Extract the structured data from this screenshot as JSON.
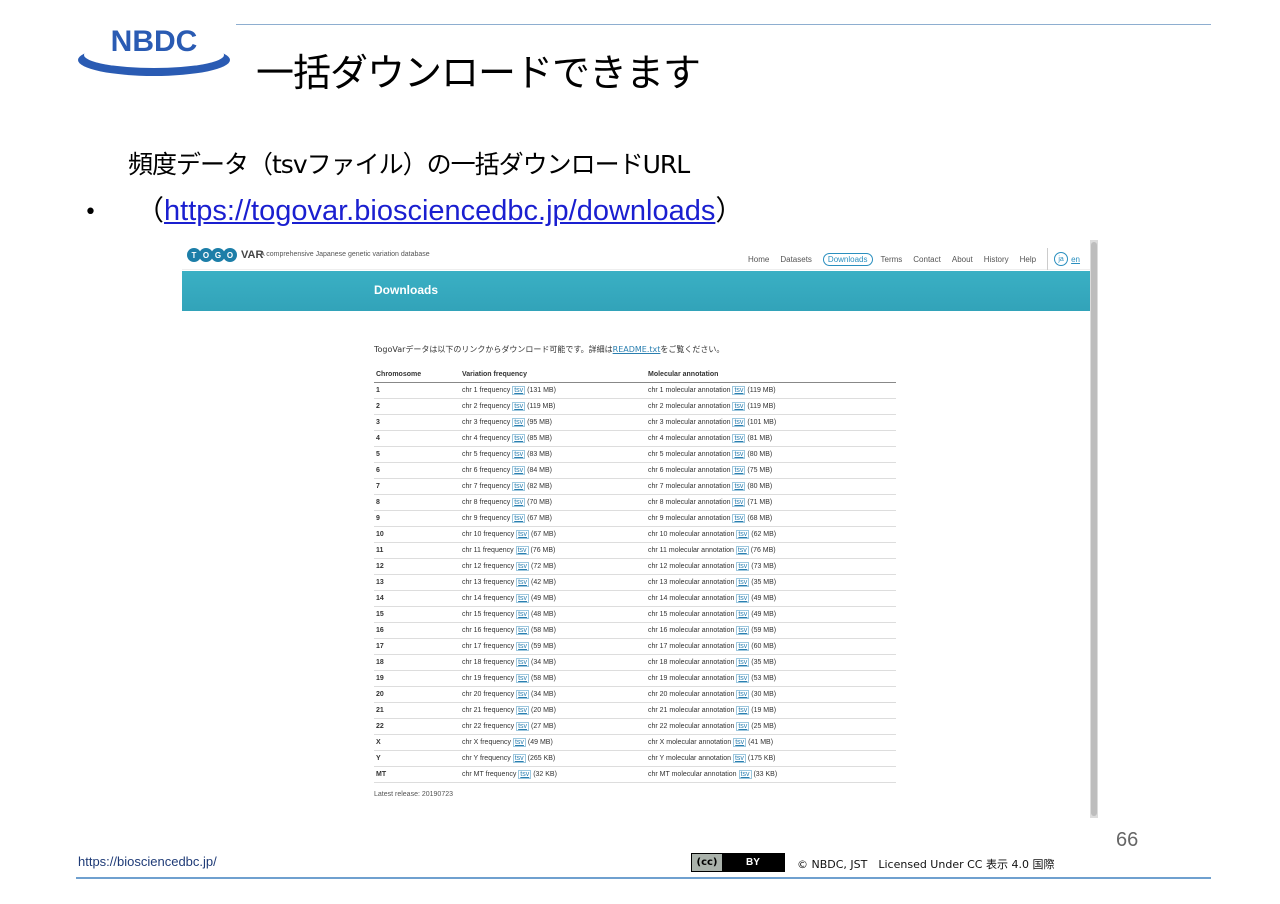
{
  "slide": {
    "brand": "NBDC",
    "title": "一括ダウンロードできます",
    "subtitle": "頻度データ（tsvファイル）の一括ダウンロードURL",
    "bullet": "•",
    "paren_open": "（",
    "link": "https://togovar.biosciencedbc.jp/downloads",
    "paren_close": "）",
    "page_number": "66",
    "footer_url": "https://biosciencedbc.jp/",
    "cc_badge": {
      "cc": "(cc)",
      "by": "BY"
    },
    "license": "© NBDC, JST　Licensed Under CC 表示 4.0 国際"
  },
  "togovar": {
    "logo_letters": [
      "T",
      "O",
      "G",
      "O"
    ],
    "logo_var": "VAR",
    "tagline": "A comprehensive Japanese genetic variation database",
    "nav": [
      "Home",
      "Datasets",
      "Downloads",
      "Terms",
      "Contact",
      "About",
      "History",
      "Help"
    ],
    "nav_active": "Downloads",
    "lang_ja": "ja",
    "lang_en": "en",
    "banner_title": "Downloads",
    "intro_before": "TogoVarデータは以下のリンクからダウンロード可能です。詳細は",
    "intro_link": "README.txt",
    "intro_after": "をご覧ください。",
    "table_headers": [
      "Chromosome",
      "Variation frequency",
      "Molecular annotation"
    ],
    "tsv_label": "tsv",
    "rows": [
      {
        "chr": "1",
        "freq": "chr 1 frequency",
        "freq_size": "(131 MB)",
        "anno": "chr 1 molecular annotation",
        "anno_size": "(119 MB)"
      },
      {
        "chr": "2",
        "freq": "chr 2 frequency",
        "freq_size": "(119 MB)",
        "anno": "chr 2 molecular annotation",
        "anno_size": "(119 MB)"
      },
      {
        "chr": "3",
        "freq": "chr 3 frequency",
        "freq_size": "(95 MB)",
        "anno": "chr 3 molecular annotation",
        "anno_size": "(101 MB)"
      },
      {
        "chr": "4",
        "freq": "chr 4 frequency",
        "freq_size": "(85 MB)",
        "anno": "chr 4 molecular annotation",
        "anno_size": "(81 MB)"
      },
      {
        "chr": "5",
        "freq": "chr 5 frequency",
        "freq_size": "(83 MB)",
        "anno": "chr 5 molecular annotation",
        "anno_size": "(80 MB)"
      },
      {
        "chr": "6",
        "freq": "chr 6 frequency",
        "freq_size": "(84 MB)",
        "anno": "chr 6 molecular annotation",
        "anno_size": "(75 MB)"
      },
      {
        "chr": "7",
        "freq": "chr 7 frequency",
        "freq_size": "(82 MB)",
        "anno": "chr 7 molecular annotation",
        "anno_size": "(80 MB)"
      },
      {
        "chr": "8",
        "freq": "chr 8 frequency",
        "freq_size": "(70 MB)",
        "anno": "chr 8 molecular annotation",
        "anno_size": "(71 MB)"
      },
      {
        "chr": "9",
        "freq": "chr 9 frequency",
        "freq_size": "(67 MB)",
        "anno": "chr 9 molecular annotation",
        "anno_size": "(68 MB)"
      },
      {
        "chr": "10",
        "freq": "chr 10 frequency",
        "freq_size": "(67 MB)",
        "anno": "chr 10 molecular annotation",
        "anno_size": "(62 MB)"
      },
      {
        "chr": "11",
        "freq": "chr 11 frequency",
        "freq_size": "(76 MB)",
        "anno": "chr 11 molecular annotation",
        "anno_size": "(76 MB)"
      },
      {
        "chr": "12",
        "freq": "chr 12 frequency",
        "freq_size": "(72 MB)",
        "anno": "chr 12 molecular annotation",
        "anno_size": "(73 MB)"
      },
      {
        "chr": "13",
        "freq": "chr 13 frequency",
        "freq_size": "(42 MB)",
        "anno": "chr 13 molecular annotation",
        "anno_size": "(35 MB)"
      },
      {
        "chr": "14",
        "freq": "chr 14 frequency",
        "freq_size": "(49 MB)",
        "anno": "chr 14 molecular annotation",
        "anno_size": "(49 MB)"
      },
      {
        "chr": "15",
        "freq": "chr 15 frequency",
        "freq_size": "(48 MB)",
        "anno": "chr 15 molecular annotation",
        "anno_size": "(49 MB)"
      },
      {
        "chr": "16",
        "freq": "chr 16 frequency",
        "freq_size": "(58 MB)",
        "anno": "chr 16 molecular annotation",
        "anno_size": "(59 MB)"
      },
      {
        "chr": "17",
        "freq": "chr 17 frequency",
        "freq_size": "(59 MB)",
        "anno": "chr 17 molecular annotation",
        "anno_size": "(60 MB)"
      },
      {
        "chr": "18",
        "freq": "chr 18 frequency",
        "freq_size": "(34 MB)",
        "anno": "chr 18 molecular annotation",
        "anno_size": "(35 MB)"
      },
      {
        "chr": "19",
        "freq": "chr 19 frequency",
        "freq_size": "(58 MB)",
        "anno": "chr 19 molecular annotation",
        "anno_size": "(53 MB)"
      },
      {
        "chr": "20",
        "freq": "chr 20 frequency",
        "freq_size": "(34 MB)",
        "anno": "chr 20 molecular annotation",
        "anno_size": "(30 MB)"
      },
      {
        "chr": "21",
        "freq": "chr 21 frequency",
        "freq_size": "(20 MB)",
        "anno": "chr 21 molecular annotation",
        "anno_size": "(19 MB)"
      },
      {
        "chr": "22",
        "freq": "chr 22 frequency",
        "freq_size": "(27 MB)",
        "anno": "chr 22 molecular annotation",
        "anno_size": "(25 MB)"
      },
      {
        "chr": "X",
        "freq": "chr X frequency",
        "freq_size": "(49 MB)",
        "anno": "chr X molecular annotation",
        "anno_size": "(41 MB)"
      },
      {
        "chr": "Y",
        "freq": "chr Y frequency",
        "freq_size": "(265 KB)",
        "anno": "chr Y molecular annotation",
        "anno_size": "(175 KB)"
      },
      {
        "chr": "MT",
        "freq": "chr MT frequency",
        "freq_size": "(32 KB)",
        "anno": "chr MT molecular annotation",
        "anno_size": "(33 KB)"
      }
    ],
    "latest_release": "Latest release: 20190723"
  }
}
